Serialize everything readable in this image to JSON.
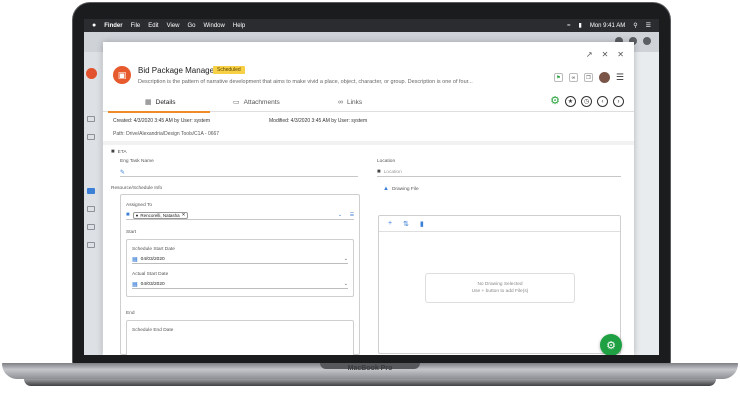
{
  "menubar": {
    "apple": "",
    "items": [
      "Finder",
      "File",
      "Edit",
      "View",
      "Go",
      "Window",
      "Help"
    ],
    "clock": "Mon 9:41 AM"
  },
  "dialog": {
    "title": "Bid Package Manager",
    "status": "Scheduled",
    "description": "Description is the pattern of narrative development that aims to make vivid a place, object, character, or group. Description is one of four...",
    "head_tool_icons": [
      "bookmark-icon",
      "link-icon",
      "copy-icon"
    ],
    "tabs": [
      {
        "label": "Details",
        "icon": "details-icon"
      },
      {
        "label": "Attachments",
        "icon": "paperclip-icon"
      },
      {
        "label": "Links",
        "icon": "link-icon"
      }
    ],
    "created": "Created: 4/3/2020 3:45 AM by User: system",
    "modified": "Modified: 4/3/2020 3:45 AM by User: system",
    "path": "Path: Drive/Alexandria/Design Tools/C1A - 0667",
    "section_label": "ETA",
    "eng_task_label": "Eng Task Name",
    "location_label": "Location",
    "location_placeholder": "Location",
    "resource_label": "Resource/Schedule Info",
    "assigned_label": "Assigned To",
    "assignee": "Rencorelli, Natasha",
    "start_label": "Start",
    "schedule_start_label": "Schedule Start Date",
    "schedule_start_value": "04/03/2020",
    "actual_start_label": "Actual Start Date",
    "actual_start_value": "04/03/2020",
    "end_label": "End",
    "schedule_end_label": "Schedule End Date",
    "drawing_label": "Drawing File",
    "empty_title": "No Drawing Selected",
    "empty_hint": "Use + button to add File(s)"
  },
  "laptop": {
    "brand": "MacBook Pro"
  },
  "colors": {
    "accent": "#f08a29",
    "green": "#1fa043",
    "badge": "#f7d046",
    "app_icon": "#e65a2e"
  }
}
